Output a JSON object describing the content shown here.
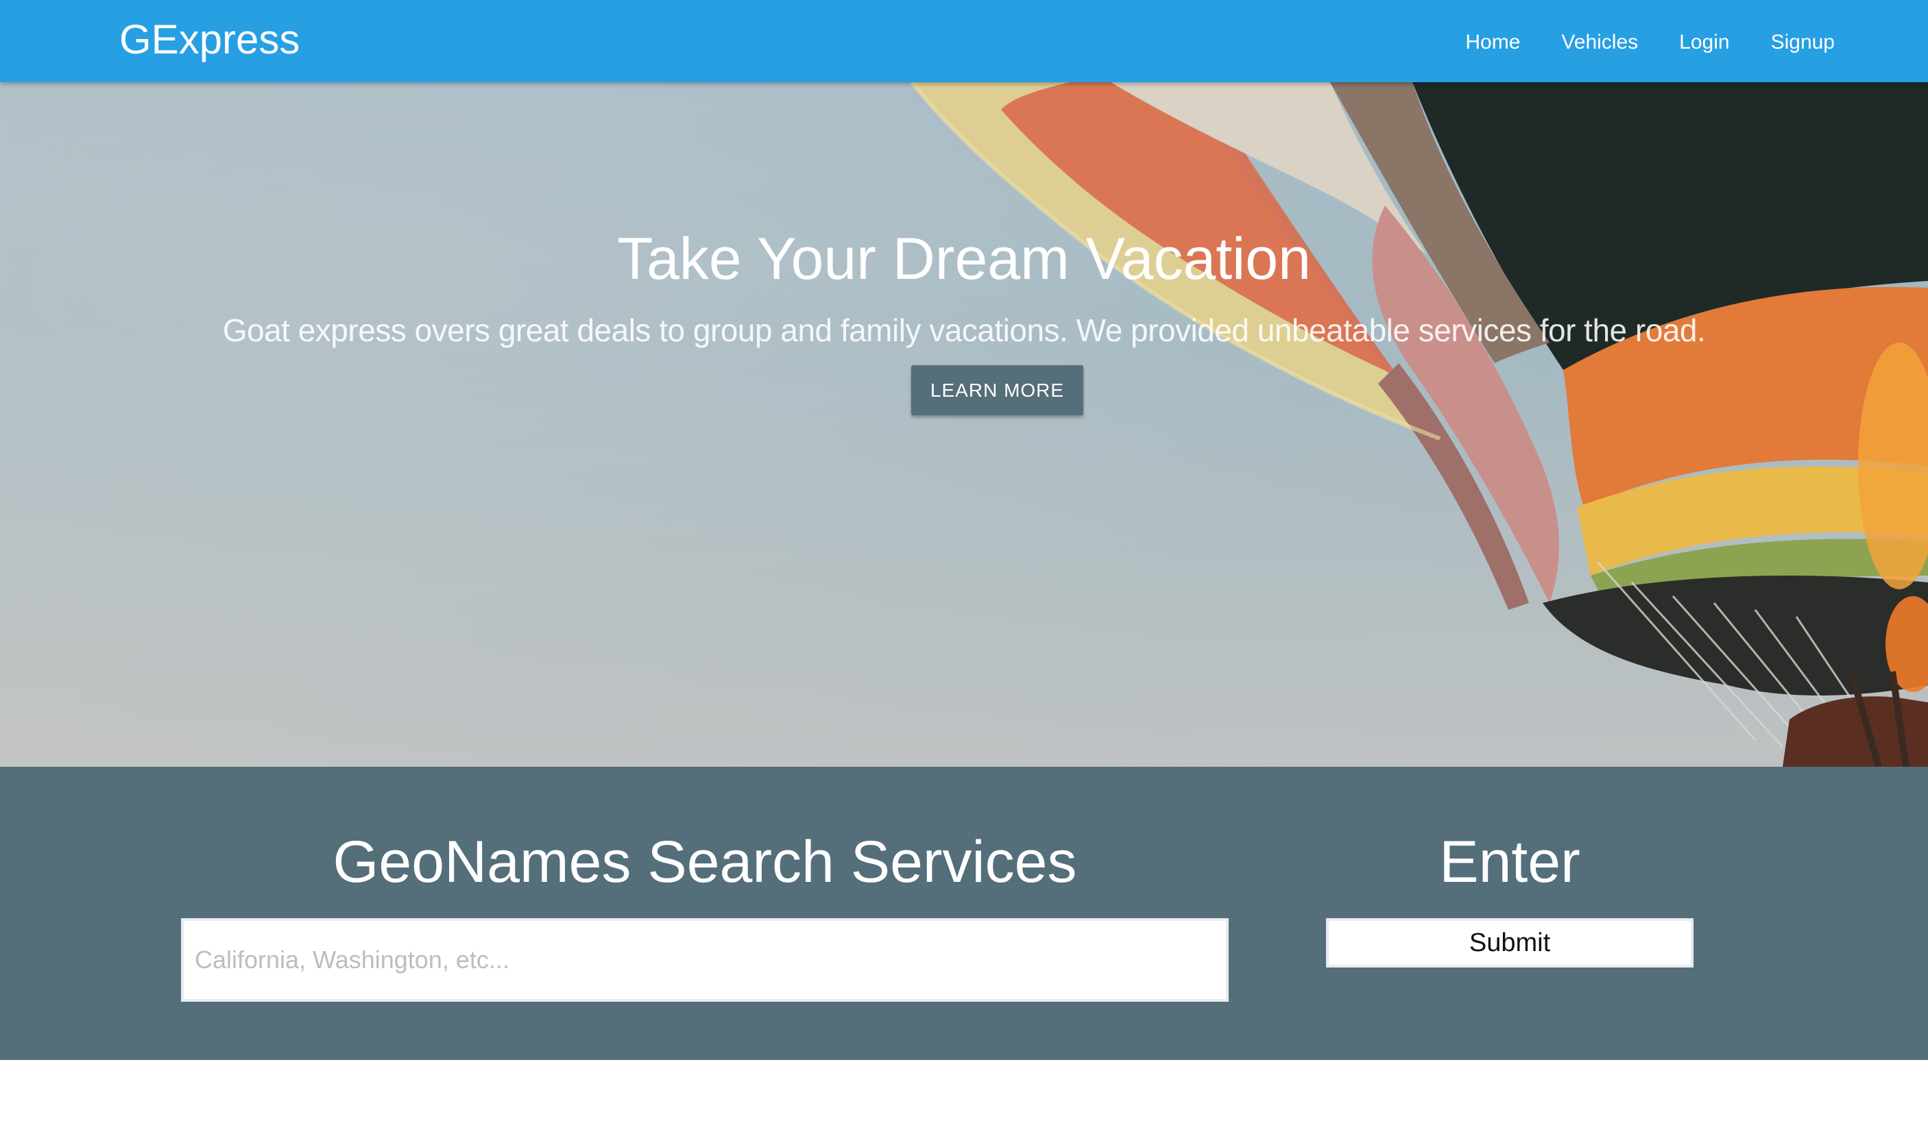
{
  "navbar": {
    "brand": "GExpress",
    "links": [
      "Home",
      "Vehicles",
      "Login",
      "Signup"
    ],
    "background": "#269fe3"
  },
  "hero": {
    "title": "Take Your Dream Vacation",
    "subtitle": "Goat express overs great deals to group and family vacations. We provided unbeatable services for the road.",
    "button_label": "LEARN MORE",
    "button_color": "#546e7a"
  },
  "search": {
    "heading": "GeoNames Search Services",
    "input_placeholder": "California, Washington, etc...",
    "input_value": "",
    "enter_heading": "Enter",
    "submit_label": "Submit",
    "background": "#546e7a"
  }
}
